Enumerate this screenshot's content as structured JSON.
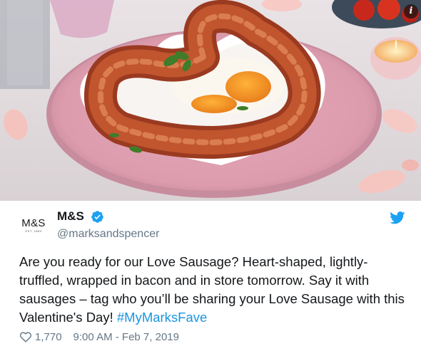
{
  "media": {
    "description_icon": "info-icon",
    "info_label": "i"
  },
  "author": {
    "logo_text": "M&S",
    "logo_subtext": "EST. 1884",
    "display_name": "M&S",
    "handle": "@marksandspencer",
    "verified_icon": "verified-badge-icon",
    "platform_icon": "twitter-bird-icon"
  },
  "tweet": {
    "text": "Are you ready for our Love Sausage? Heart-shaped, lightly-truffled, wrapped in bacon and in store tomorrow. Say it with sausages – tag who you’ll be sharing your Love Sausage with this Valentine's Day! ",
    "hashtag": "#MyMarksFave",
    "like_count": "1,770",
    "timestamp": "9:00 AM - Feb 7, 2019"
  },
  "colors": {
    "link": "#1b95e0",
    "twitter_blue": "#1da1f2",
    "meta_gray": "#657786",
    "text": "#14171a"
  }
}
